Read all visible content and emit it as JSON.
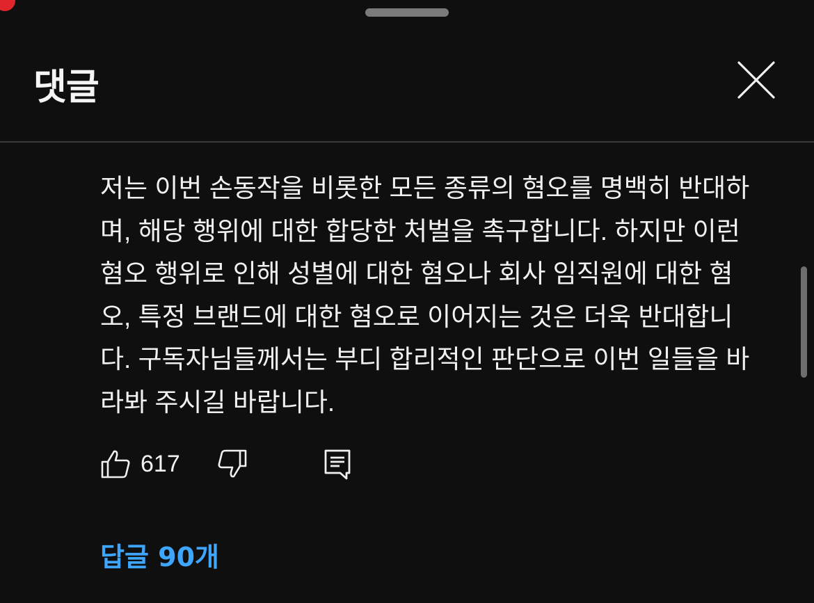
{
  "header": {
    "title": "댓글"
  },
  "comment": {
    "text": "저는 이번 손동작을 비롯한 모든 종류의 혐오를 명백히 반대하며, 해당 행위에 대한 합당한 처벌을 촉구합니다. 하지만 이런 혐오 행위로 인해 성별에 대한 혐오나 회사 임직원에 대한 혐오, 특정 브랜드에 대한 혐오로 이어지는 것은 더욱 반대합니다. 구독자님들께서는 부디 합리적인 판단으로 이번 일들을 바라봐 주시길 바랍니다.",
    "like_count": "617",
    "replies_label": "답글 90개"
  },
  "icons": {
    "close": "close-icon",
    "like": "thumbs-up-icon",
    "dislike": "thumbs-down-icon",
    "reply": "reply-comment-icon"
  },
  "colors": {
    "background": "#0f0f0f",
    "text": "#f1f1f1",
    "link": "#3ea6ff",
    "divider": "#3a3a3a"
  }
}
